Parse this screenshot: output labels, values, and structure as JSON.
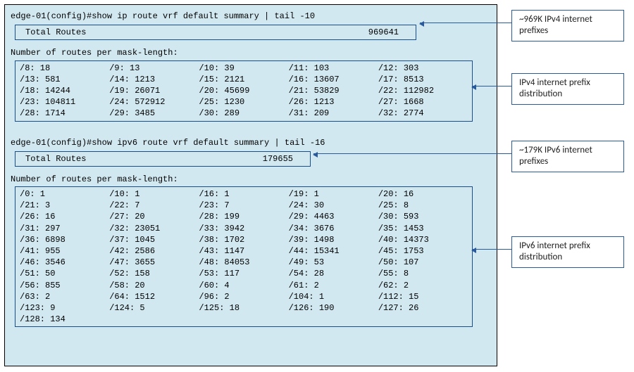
{
  "ipv4": {
    "cmd": "edge-01(config)#show ip route vrf default summary | tail -10",
    "total_label": "Total Routes",
    "total_value": "969641",
    "section_head": "Number of routes per mask-length:",
    "dist": [
      [
        "/8: 18",
        "/9: 13",
        "/10: 39",
        "/11: 103",
        "/12: 303"
      ],
      [
        "/13: 581",
        "/14: 1213",
        "/15: 2121",
        "/16: 13607",
        "/17: 8513"
      ],
      [
        "/18: 14244",
        "/19: 26071",
        "/20: 45699",
        "/21: 53829",
        "/22: 112982"
      ],
      [
        "/23: 104811",
        "/24: 572912",
        "/25: 1230",
        "/26: 1213",
        "/27: 1668"
      ],
      [
        "/28: 1714",
        "/29: 3485",
        "/30: 289",
        "/31: 209",
        "/32: 2774"
      ]
    ]
  },
  "ipv6": {
    "cmd": "edge-01(config)#show ipv6 route vrf default summary | tail -16",
    "total_label": "Total Routes",
    "total_value": "179655",
    "section_head": "Number of routes per mask-length:",
    "dist": [
      [
        "/0: 1",
        "/10: 1",
        "/16: 1",
        "/19: 1",
        "/20: 16"
      ],
      [
        "/21: 3",
        "/22: 7",
        "/23: 7",
        "/24: 30",
        "/25: 8"
      ],
      [
        "/26: 16",
        "/27: 20",
        "/28: 199",
        "/29: 4463",
        "/30: 593"
      ],
      [
        "/31: 297",
        "/32: 23051",
        "/33: 3942",
        "/34: 3676",
        "/35: 1453"
      ],
      [
        "/36: 6898",
        "/37: 1045",
        "/38: 1702",
        "/39: 1498",
        "/40: 14373"
      ],
      [
        "/41: 955",
        "/42: 2586",
        "/43: 1147",
        "/44: 15341",
        "/45: 1753"
      ],
      [
        "/46: 3546",
        "/47: 3655",
        "/48: 84053",
        "/49: 53",
        "/50: 107"
      ],
      [
        "/51: 50",
        "/52: 158",
        "/53: 117",
        "/54: 28",
        "/55: 8"
      ],
      [
        "/56: 855",
        "/58: 20",
        "/60: 4",
        "/61: 2",
        "/62: 2"
      ],
      [
        "/63: 2",
        "/64: 1512",
        "/96: 2",
        "/104: 1",
        "/112: 15"
      ],
      [
        "/123: 9",
        "/124: 5",
        "/125: 18",
        "/126: 190",
        "/127: 26"
      ],
      [
        "/128: 134",
        "",
        "",
        "",
        ""
      ]
    ]
  },
  "callouts": {
    "c1": "~969K IPv4 internet prefixes",
    "c2": "IPv4 internet prefix distribution",
    "c3": "~179K IPv6 internet prefixes",
    "c4": "IPv6 internet prefix distribution"
  },
  "chart_data": {
    "type": "table",
    "title": "Routes per mask-length (IPv4 and IPv6)",
    "ipv4_total": 969641,
    "ipv6_total": 179655,
    "ipv4_mask_counts": {
      "8": 18,
      "9": 13,
      "10": 39,
      "11": 103,
      "12": 303,
      "13": 581,
      "14": 1213,
      "15": 2121,
      "16": 13607,
      "17": 8513,
      "18": 14244,
      "19": 26071,
      "20": 45699,
      "21": 53829,
      "22": 112982,
      "23": 104811,
      "24": 572912,
      "25": 1230,
      "26": 1213,
      "27": 1668,
      "28": 1714,
      "29": 3485,
      "30": 289,
      "31": 209,
      "32": 2774
    },
    "ipv6_mask_counts": {
      "0": 1,
      "10": 1,
      "16": 1,
      "19": 1,
      "20": 16,
      "21": 3,
      "22": 7,
      "23": 7,
      "24": 30,
      "25": 8,
      "26": 16,
      "27": 20,
      "28": 199,
      "29": 4463,
      "30": 593,
      "31": 297,
      "32": 23051,
      "33": 3942,
      "34": 3676,
      "35": 1453,
      "36": 6898,
      "37": 1045,
      "38": 1702,
      "39": 1498,
      "40": 14373,
      "41": 955,
      "42": 2586,
      "43": 1147,
      "44": 15341,
      "45": 1753,
      "46": 3546,
      "47": 3655,
      "48": 84053,
      "49": 53,
      "50": 107,
      "51": 50,
      "52": 158,
      "53": 117,
      "54": 28,
      "55": 8,
      "56": 855,
      "58": 20,
      "60": 4,
      "61": 2,
      "62": 2,
      "63": 2,
      "64": 1512,
      "96": 2,
      "104": 1,
      "112": 15,
      "123": 9,
      "124": 5,
      "125": 18,
      "126": 190,
      "127": 26,
      "128": 134
    }
  }
}
